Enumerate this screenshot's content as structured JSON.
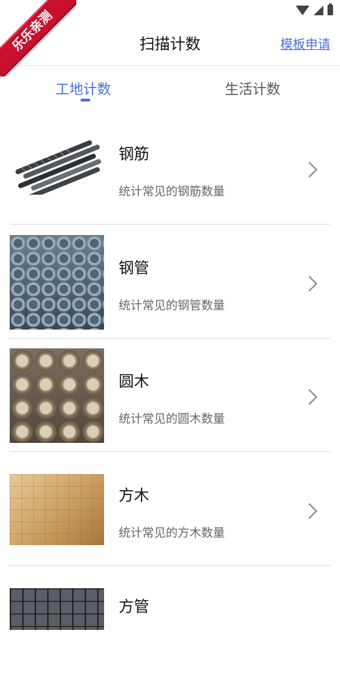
{
  "watermark": "乐乐亲测",
  "header": {
    "title": "扫描计数",
    "template_link": "模板申请"
  },
  "tabs": [
    {
      "label": "工地计数",
      "active": true
    },
    {
      "label": "生活计数",
      "active": false
    }
  ],
  "items": [
    {
      "name": "钢筋",
      "desc": "统计常见的钢筋数量",
      "image": "rebar"
    },
    {
      "name": "钢管",
      "desc": "统计常见的钢管数量",
      "image": "steel-pipes"
    },
    {
      "name": "圆木",
      "desc": "统计常见的圆木数量",
      "image": "logs"
    },
    {
      "name": "方木",
      "desc": "统计常见的方木数量",
      "image": "square-timber"
    },
    {
      "name": "方管",
      "desc": "",
      "image": "square-tubes"
    }
  ],
  "colors": {
    "accent": "#4a6fd8",
    "ribbon": "#c8102e",
    "separator": "#dcdcdc"
  }
}
